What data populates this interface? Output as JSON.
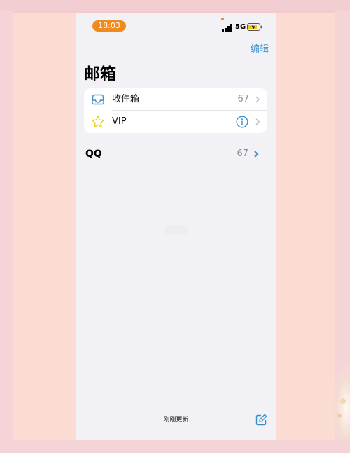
{
  "status_bar": {
    "time": "18:03",
    "network": "5G",
    "icons": [
      "signal-bars-icon",
      "battery-charging-icon"
    ],
    "accent_color": "#f08a1c"
  },
  "nav": {
    "edit_label": "编辑"
  },
  "page": {
    "title": "邮箱"
  },
  "mailboxes": [
    {
      "label": "收件箱",
      "count": "67",
      "icon": "inbox-tray-icon",
      "icon_color": "#3a8fc8"
    },
    {
      "label": "VIP",
      "icon": "star-icon",
      "icon_color": "#e8d21b",
      "trailing_icon": "info-icon"
    }
  ],
  "accounts": [
    {
      "label": "QQ",
      "count": "67",
      "chevron_color": "#3a8fc8"
    }
  ],
  "footer": {
    "status_text": "刚刚更新",
    "compose_icon": "compose-icon"
  },
  "colors": {
    "accent": "#3a8fc8",
    "background": "#f1f1f6",
    "card": "#ffffff"
  }
}
